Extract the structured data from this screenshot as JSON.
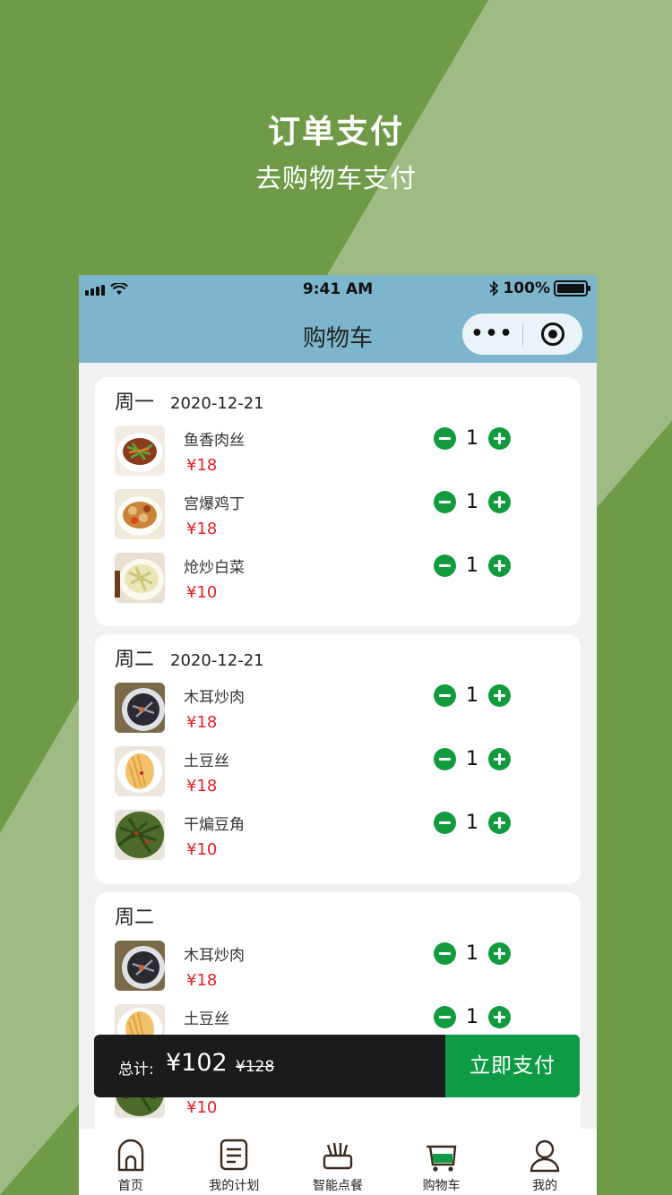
{
  "promo": {
    "title": "订单支付",
    "subtitle": "去购物车支付"
  },
  "status_bar": {
    "time": "9:41 AM",
    "battery": "100%"
  },
  "nav": {
    "title": "购物车",
    "menu_icon": "more-dots-icon",
    "close_icon": "record-icon"
  },
  "colors": {
    "accent": "#0f9b46",
    "price": "#e0202a",
    "header": "#7db6cc",
    "background": "#6f9a48"
  },
  "days": [
    {
      "day": "周一",
      "date": "2020-12-21",
      "items": [
        {
          "name": "鱼香肉丝",
          "price": "¥18",
          "qty": "1",
          "thumb": "shredded-pork-photo"
        },
        {
          "name": "宫爆鸡丁",
          "price": "¥18",
          "qty": "1",
          "thumb": "kungpao-chicken-photo"
        },
        {
          "name": "炝炒白菜",
          "price": "¥10",
          "qty": "1",
          "thumb": "cabbage-photo"
        }
      ]
    },
    {
      "day": "周二",
      "date": "2020-12-21",
      "items": [
        {
          "name": "木耳炒肉",
          "price": "¥18",
          "qty": "1",
          "thumb": "fungus-pork-photo"
        },
        {
          "name": "土豆丝",
          "price": "¥18",
          "qty": "1",
          "thumb": "potato-shreds-photo"
        },
        {
          "name": "干煸豆角",
          "price": "¥10",
          "qty": "1",
          "thumb": "green-beans-photo"
        }
      ]
    },
    {
      "day": "周二",
      "date": "",
      "items": [
        {
          "name": "木耳炒肉",
          "price": "¥18",
          "qty": "1",
          "thumb": "fungus-pork-photo"
        },
        {
          "name": "土豆丝",
          "price": "",
          "qty": "1",
          "thumb": "potato-shreds-photo"
        },
        {
          "name": "",
          "price": "¥10",
          "qty": "",
          "thumb": "green-beans-photo"
        }
      ]
    }
  ],
  "checkout": {
    "label": "总计:",
    "total": "¥102",
    "original": "¥128",
    "pay_button": "立即支付"
  },
  "tabs": [
    {
      "label": "首页",
      "icon": "home-icon"
    },
    {
      "label": "我的计划",
      "icon": "plan-list-icon"
    },
    {
      "label": "智能点餐",
      "icon": "smart-order-icon"
    },
    {
      "label": "购物车",
      "icon": "cart-icon"
    },
    {
      "label": "我的",
      "icon": "profile-icon"
    }
  ]
}
